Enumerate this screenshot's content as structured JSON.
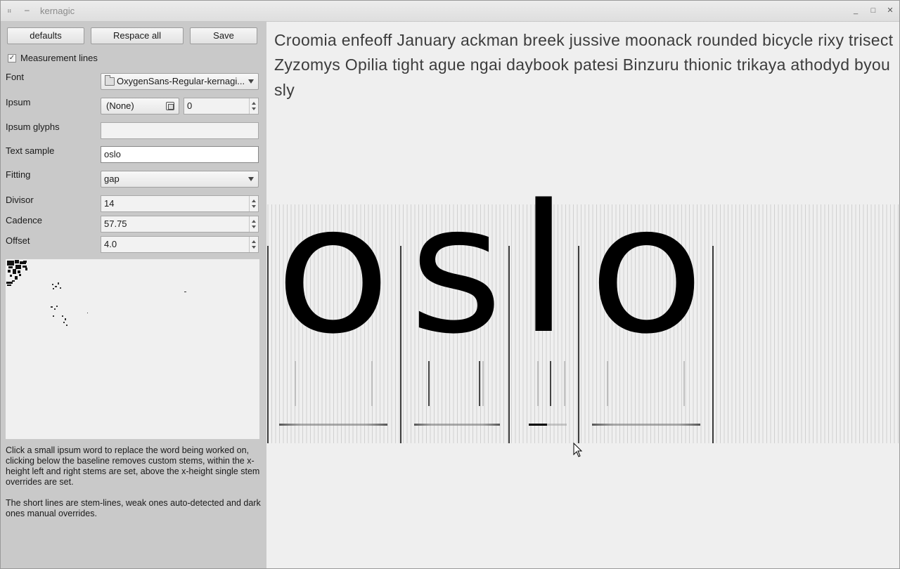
{
  "window": {
    "title": "kernagic"
  },
  "toolbar": {
    "defaults_label": "defaults",
    "respace_label": "Respace all",
    "save_label": "Save"
  },
  "measurement": {
    "label": "Measurement lines",
    "checked": true
  },
  "form": {
    "font_label": "Font",
    "font_value": "OxygenSans-Regular-kernagi...",
    "ipsum_label": "Ipsum",
    "ipsum_value": "(None)",
    "ipsum_number": "0",
    "ipsum_glyphs_label": "Ipsum glyphs",
    "ipsum_glyphs_value": "",
    "text_sample_label": "Text sample",
    "text_sample_value": "oslo",
    "fitting_label": "Fitting",
    "fitting_value": "gap",
    "divisor_label": "Divisor",
    "divisor_value": "14",
    "cadence_label": "Cadence",
    "cadence_value": "57.75",
    "offset_label": "Offset",
    "offset_value": "4.0"
  },
  "help": {
    "para1": "Click a small ipsum word to replace the word being worked on, clicking below the baseline removes custom stems, within the x-height left and right stems are set, above the x-height single stem overrides are set.",
    "para2": "The short lines are stem-lines, weak ones auto-detected and dark ones manual overrides."
  },
  "ipsum": {
    "line1": "Croomia enfeoff January ackman breek jussive moonack rounded bicycle rixy trisect",
    "line2": "Zyzomys Opilia tight ague ngai daybook patesi Binzuru thionic trikaya athodyd byou",
    "line3": "sly"
  },
  "sample": {
    "glyphs": [
      "o",
      "s",
      "l",
      "o"
    ]
  },
  "colors": {
    "sidebar": "#c9c9c9",
    "canvas": "#efefef",
    "ink": "#000000"
  },
  "icons": {
    "folder": "folder-icon",
    "clear": "clear-icon",
    "cursor": "pointer-cursor-icon"
  }
}
